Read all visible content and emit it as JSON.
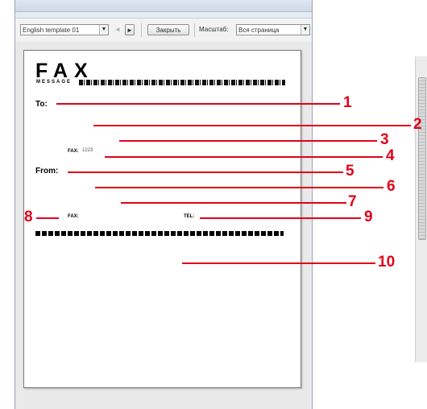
{
  "toolbar": {
    "template_select": "English template 01",
    "close_button": "Закрыть",
    "scale_label": "Масштаб:",
    "scale_select": "Вся страница",
    "prev_glyph": "◄",
    "next_glyph": "►",
    "dropdown_glyph": "▼"
  },
  "fax": {
    "title": "FAX",
    "subtitle": "MESSAGE",
    "to_label": "To:",
    "to_fax_label": "FAX:",
    "to_fax_value": "1223",
    "from_label": "From:",
    "from_fax_label": "FAX:",
    "from_tel_label": "TEL:"
  },
  "callouts": [
    "1",
    "2",
    "3",
    "4",
    "5",
    "6",
    "7",
    "8",
    "9",
    "10"
  ],
  "colors": {
    "callout": "#e2001a",
    "window_chrome": "#e6ecf4"
  }
}
